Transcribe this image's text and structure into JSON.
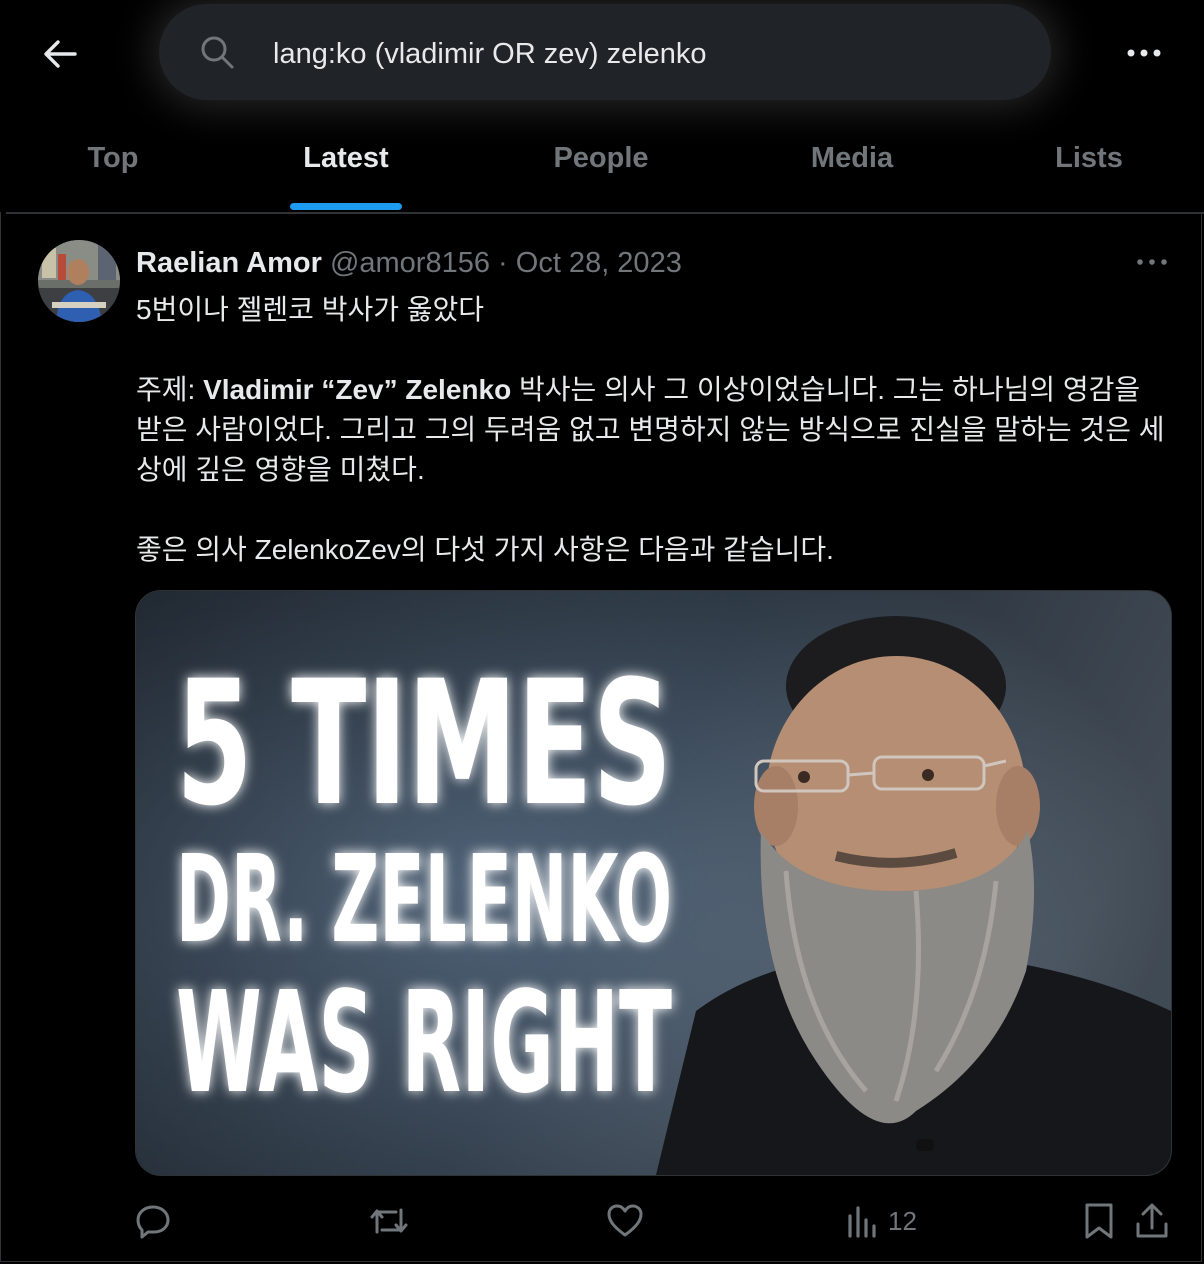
{
  "header": {
    "search_value": "lang:ko (vladimir OR zev) zelenko",
    "tabs": [
      {
        "label": "Top",
        "active": false
      },
      {
        "label": "Latest",
        "active": true
      },
      {
        "label": "People",
        "active": false
      },
      {
        "label": "Media",
        "active": false
      },
      {
        "label": "Lists",
        "active": false
      }
    ]
  },
  "tweet": {
    "author_name": "Raelian Amor",
    "handle": "@amor8156",
    "separator": "·",
    "date": "Oct 28, 2023",
    "line1": "5번이나 젤렌코 박사가 옳았다",
    "p2_prefix": "주제: ",
    "p2_bold": "Vladimir “Zev” Zelenko",
    "p2_rest": " 박사는 의사 그 이상이었습니다. 그는 하나님의 영감을 받은 사람이었다. 그리고 그의 두려움 없고 변명하지 않는 방식으로 진실을 말하는 것은 세상에 깊은 영향을 미쳤다.",
    "p3": "좋은 의사 ZelenkoZev의 다섯 가지 사항은 다음과 같습니다.",
    "media_lines": [
      "5 TIMES",
      "DR. ZELENKO",
      "WAS RIGHT"
    ],
    "views": "12"
  },
  "colors": {
    "accent": "#1d9bf0",
    "muted": "#71767b",
    "text": "#e7e9ea",
    "background": "#000000"
  },
  "icons": [
    "back-arrow-icon",
    "search-icon",
    "more-icon",
    "reply-icon",
    "retweet-icon",
    "like-icon",
    "views-icon",
    "bookmark-icon",
    "share-icon"
  ]
}
